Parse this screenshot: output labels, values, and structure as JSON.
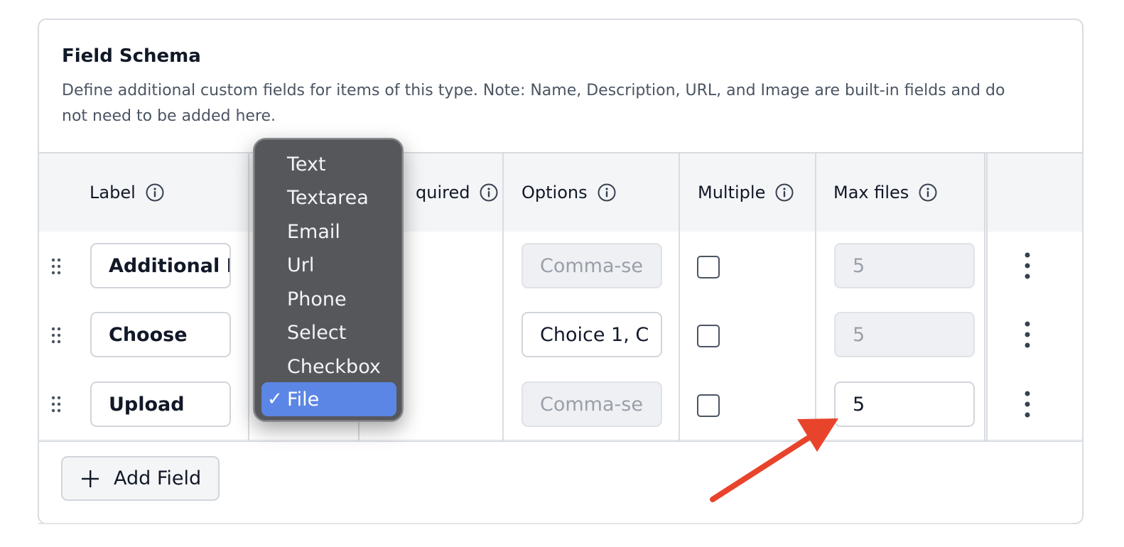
{
  "section": {
    "title": "Field Schema",
    "description": "Define additional custom fields for items of this type. Note: Name, Description, URL, and Image are built-in fields and do not need to be added here."
  },
  "table": {
    "headers": {
      "label": "Label",
      "required": "quired",
      "options": "Options",
      "multiple": "Multiple",
      "max_files": "Max files"
    },
    "rows": [
      {
        "label": "Additional I",
        "options": "Comma-se",
        "options_disabled": true,
        "multiple": false,
        "max_files": "5",
        "max_files_disabled": true
      },
      {
        "label": "Choose",
        "options": "Choice 1, C",
        "options_disabled": false,
        "multiple": false,
        "max_files": "5",
        "max_files_disabled": true
      },
      {
        "label": "Upload",
        "options": "Comma-se",
        "options_disabled": true,
        "multiple": false,
        "max_files": "5",
        "max_files_disabled": false
      }
    ]
  },
  "add_field": {
    "label": "Add Field",
    "icon": "plus-icon"
  },
  "type_dropdown": {
    "options": [
      "Text",
      "Textarea",
      "Email",
      "Url",
      "Phone",
      "Select",
      "Checkbox",
      "File"
    ],
    "selected": "File",
    "check_mark": "✓"
  },
  "colors": {
    "accent": "#5b86e5",
    "annotation_arrow": "#e8442c",
    "border": "#d8dce2"
  }
}
